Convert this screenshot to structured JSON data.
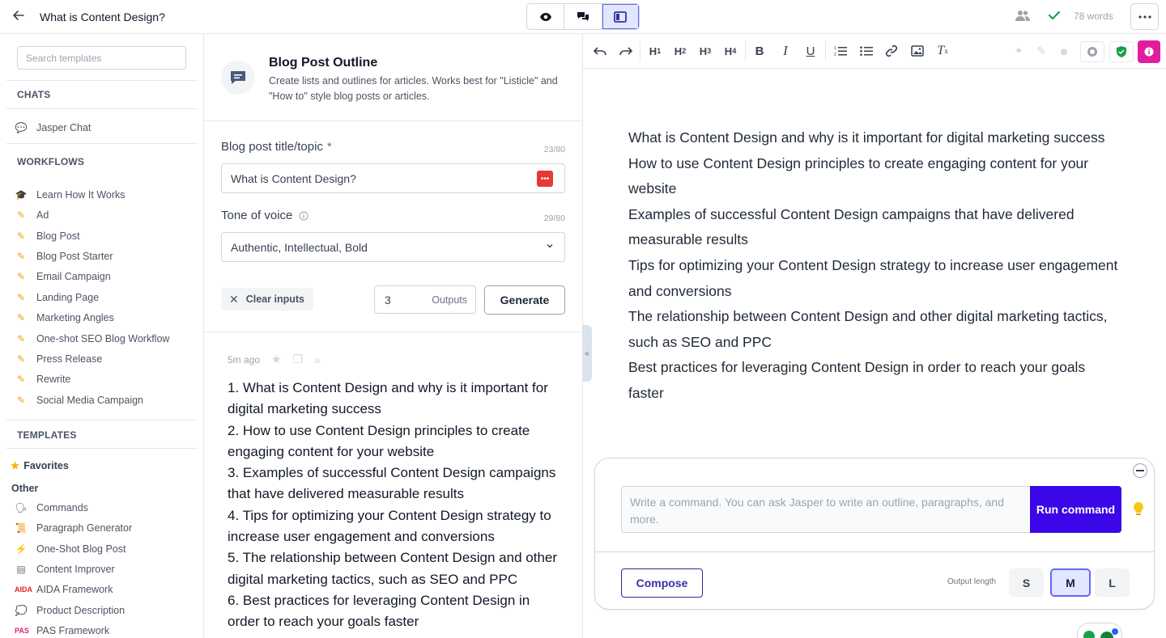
{
  "header": {
    "doc_title": "What is Content Design?",
    "word_count": "78 words"
  },
  "sidebar": {
    "search_placeholder": "Search templates",
    "chats_heading": "CHATS",
    "chats": [
      {
        "label": "Jasper Chat",
        "icon": "speech-bubble-icon"
      }
    ],
    "workflows_heading": "WORKFLOWS",
    "workflows": [
      {
        "label": "Learn How It Works",
        "icon": "graduation-cap-icon"
      },
      {
        "label": "Ad",
        "icon": "jasper-logo-icon"
      },
      {
        "label": "Blog Post",
        "icon": "jasper-logo-icon"
      },
      {
        "label": "Blog Post Starter",
        "icon": "jasper-logo-icon"
      },
      {
        "label": "Email Campaign",
        "icon": "jasper-logo-icon"
      },
      {
        "label": "Landing Page",
        "icon": "jasper-logo-icon"
      },
      {
        "label": "Marketing Angles",
        "icon": "jasper-logo-icon"
      },
      {
        "label": "One-shot SEO Blog Workflow",
        "icon": "jasper-logo-icon"
      },
      {
        "label": "Press Release",
        "icon": "jasper-logo-icon"
      },
      {
        "label": "Rewrite",
        "icon": "jasper-logo-icon"
      },
      {
        "label": "Social Media Campaign",
        "icon": "jasper-logo-icon"
      }
    ],
    "templates_heading": "TEMPLATES",
    "favorites_label": "Favorites",
    "other_label": "Other",
    "templates": [
      {
        "label": "Commands",
        "icon": "speaking-head-icon"
      },
      {
        "label": "Paragraph Generator",
        "icon": "scroll-icon"
      },
      {
        "label": "One-Shot Blog Post",
        "icon": "lightning-icon"
      },
      {
        "label": "Content Improver",
        "icon": "document-icon"
      },
      {
        "label": "AIDA Framework",
        "icon": "aida-badge-icon"
      },
      {
        "label": "Product Description",
        "icon": "speech-bubble-icon"
      },
      {
        "label": "PAS Framework",
        "icon": "pas-badge-icon"
      }
    ]
  },
  "template": {
    "title": "Blog Post Outline",
    "description": "Create lists and outlines for articles. Works best for \"Listicle\" and \"How to\" style blog posts or articles.",
    "topic_label": "Blog post title/topic",
    "required_mark": "*",
    "topic_count": "23/80",
    "topic_value": "What is Content Design?",
    "tone_label": "Tone of voice",
    "tone_count": "29/80",
    "tone_value": "Authentic, Intellectual, Bold",
    "clear_label": "Clear inputs",
    "outputs_value": "3",
    "outputs_label": "Outputs",
    "generate_label": "Generate"
  },
  "result": {
    "time_ago": "5m ago",
    "lines": [
      "1. What is Content Design and why is it important for digital marketing success",
      "2. How to use Content Design principles to create engaging content for your website",
      "3. Examples of successful Content Design campaigns that have delivered measurable results",
      "4. Tips for optimizing your Content Design strategy to increase user engagement and conversions",
      "5. The relationship between Content Design and other digital marketing tactics, such as SEO and PPC",
      "6. Best practices for leveraging Content Design in order to reach your goals faster"
    ]
  },
  "editor": {
    "paragraphs": [
      "What is Content Design and why is it important for digital marketing success",
      "How to use Content Design principles to create engaging content for your website",
      "Examples of successful Content Design campaigns that have delivered measurable results",
      "Tips for optimizing your Content Design strategy to increase user engagement and conversions",
      "The relationship between Content Design and other digital marketing tactics, such as SEO and PPC",
      "Best practices for leveraging Content Design in order to reach your goals faster"
    ]
  },
  "command": {
    "placeholder": "Write a command. You can ask Jasper to write an outline, paragraphs, and more.",
    "run_label": "Run command",
    "compose_label": "Compose",
    "output_length_label": "Output length",
    "sizes": [
      "S",
      "M",
      "L"
    ],
    "selected_size": "M"
  },
  "colors": {
    "brand_purple": "#3b07e8",
    "accent_pink": "#e11d9e",
    "success_green": "#16a34a",
    "grammarly_red": "#e53935"
  }
}
